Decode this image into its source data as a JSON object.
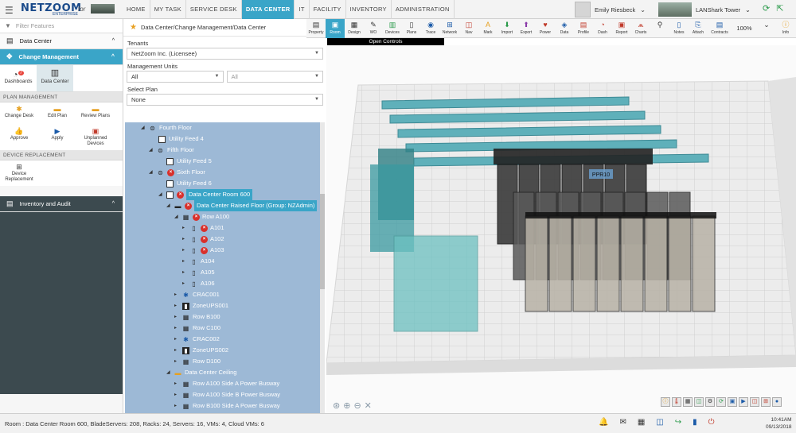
{
  "app": {
    "logo": "NETZOOM",
    "logo_sub": "ENTERPRISE",
    "logo_for": "for"
  },
  "nav": [
    "HOME",
    "MY TASK",
    "SERVICE DESK",
    "DATA CENTER",
    "IT",
    "FACILITY",
    "INVENTORY",
    "ADMINISTRATION"
  ],
  "nav_active": "DATA CENTER",
  "user": {
    "name": "Emily Riesbeck"
  },
  "site": {
    "name": "LANShark Tower"
  },
  "sidebar": {
    "filter_placeholder": "Filter Features",
    "data_center": "Data Center",
    "change_mgmt": "Change Management",
    "tiles": [
      {
        "label": "Dashboards",
        "badge": "7"
      },
      {
        "label": "Data Center"
      }
    ],
    "plan_mgmt_title": "PLAN MANAGEMENT",
    "plan_actions": [
      "Change Desk",
      "Edit Plan",
      "Review Plans",
      "Approve",
      "Apply",
      "Unplanned Devices"
    ],
    "device_repl_title": "DEVICE REPLACEMENT",
    "device_repl": "Device Replacement",
    "inventory": "Inventory and Audit"
  },
  "middle": {
    "breadcrumb": "Data Center/Change Management/Data Center",
    "tenants_label": "Tenants",
    "tenants_value": "NetZoom Inc. (Licensee)",
    "mgmt_units_label": "Management Units",
    "mgmt_units_value1": "All",
    "mgmt_units_value2": "All",
    "plan_label": "Select Plan",
    "plan_value": "None"
  },
  "tree": [
    {
      "label": "Fourth Floor"
    },
    {
      "label": "Utility Feed 4"
    },
    {
      "label": "Fifth Floor"
    },
    {
      "label": "Utility Feed 5"
    },
    {
      "label": "Sixth Floor"
    },
    {
      "label": "Utility Feed 6"
    },
    {
      "label": "Data Center Room 600"
    },
    {
      "label": "Data Center Raised Floor (Group: NZAdmin)"
    },
    {
      "label": "Row A100"
    },
    {
      "label": "A101"
    },
    {
      "label": "A102"
    },
    {
      "label": "A103"
    },
    {
      "label": "A104"
    },
    {
      "label": "A105"
    },
    {
      "label": "A106"
    },
    {
      "label": "CRAC001"
    },
    {
      "label": "ZoneUPS001"
    },
    {
      "label": "Row B100"
    },
    {
      "label": "Row C100"
    },
    {
      "label": "CRAC002"
    },
    {
      "label": "ZoneUPS002"
    },
    {
      "label": "Row D100"
    },
    {
      "label": "Data Center Ceiling"
    },
    {
      "label": "Row A100 Side A Power Busway"
    },
    {
      "label": "Row A100 Side B Power Busway"
    },
    {
      "label": "Row B100 Side A Power Busway"
    }
  ],
  "toolbar": [
    "Property",
    "Room",
    "Design",
    "WO",
    "Devices",
    "Plans",
    "Trace",
    "Network",
    "Nav",
    "Mark",
    "Import",
    "Export",
    "Power",
    "Data",
    "Profile",
    "Dash",
    "Report",
    "Charts",
    "",
    "Notes",
    "Attach",
    "Contracts"
  ],
  "zoom": "100%",
  "info_label": "Info",
  "tooltip": "Open Controls",
  "rack_label": "PPR10",
  "status": {
    "text": "Room : Data Center Room 600, BladeServers: 208, Racks: 24, Servers: 16, VMs: 4, Cloud VMs: 6",
    "time": "10:41AM",
    "date": "09/13/2018"
  }
}
